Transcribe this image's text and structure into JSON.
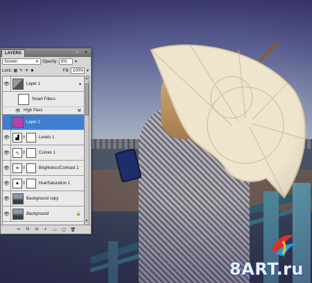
{
  "panel": {
    "tab_label": "LAYERS",
    "blend_mode": "Screen",
    "opacity_label": "Opacity:",
    "opacity_value": "6%",
    "lock_label": "Lock:",
    "fill_label": "Fill:",
    "fill_value": "100%",
    "layers": [
      {
        "name": "Layer 1",
        "thumb": "photo",
        "selected": false
      },
      {
        "name": "Smart Filters",
        "type": "smart-filters"
      },
      {
        "name": "High Pass",
        "type": "filter"
      },
      {
        "name": "Layer 2",
        "thumb": "purple",
        "selected": true
      },
      {
        "name": "Levels 1",
        "type": "adjustment"
      },
      {
        "name": "Curves 1",
        "type": "adjustment"
      },
      {
        "name": "Brightness/Contrast 1",
        "type": "adjustment"
      },
      {
        "name": "Hue/Saturation 1",
        "type": "adjustment"
      },
      {
        "name": "Background copy",
        "thumb": "photo"
      },
      {
        "name": "Background",
        "thumb": "photo",
        "italic": true
      }
    ],
    "selection_color": "#3f7fd2"
  },
  "watermark": {
    "text": "8ART.ru"
  }
}
